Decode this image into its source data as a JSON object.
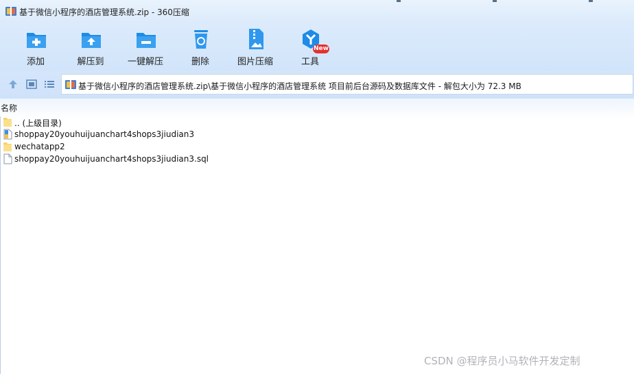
{
  "window": {
    "title": "基于微信小程序的酒店管理系统.zip - 360压缩"
  },
  "toolbar": {
    "items": [
      {
        "label": "添加",
        "icon": "add-file-icon"
      },
      {
        "label": "解压到",
        "icon": "extract-to-icon"
      },
      {
        "label": "一键解压",
        "icon": "one-click-extract-icon"
      },
      {
        "label": "删除",
        "icon": "trash-icon"
      },
      {
        "label": "图片压缩",
        "icon": "image-compress-icon"
      },
      {
        "label": "工具",
        "icon": "tools-icon"
      }
    ],
    "new_badge": "New"
  },
  "address": {
    "path": "基于微信小程序的酒店管理系统.zip\\基于微信小程序的酒店管理系统 项目前后台源码及数据库文件 - 解包大小为 72.3 MB"
  },
  "list": {
    "column_name": "名称",
    "rows": [
      {
        "name": ".. (上级目录)",
        "icon": "folder-icon"
      },
      {
        "name": "shoppay20youhuijuanchart4shops3jiudian3",
        "icon": "file-icon"
      },
      {
        "name": "wechatapp2",
        "icon": "folder-icon"
      },
      {
        "name": "shoppay20youhuijuanchart4shops3jiudian3.sql",
        "icon": "file-icon"
      }
    ]
  },
  "watermark": "CSDN @程序员小马软件开发定制",
  "colors": {
    "accent_blue": "#1e8be8",
    "badge_red": "#e5302f"
  }
}
